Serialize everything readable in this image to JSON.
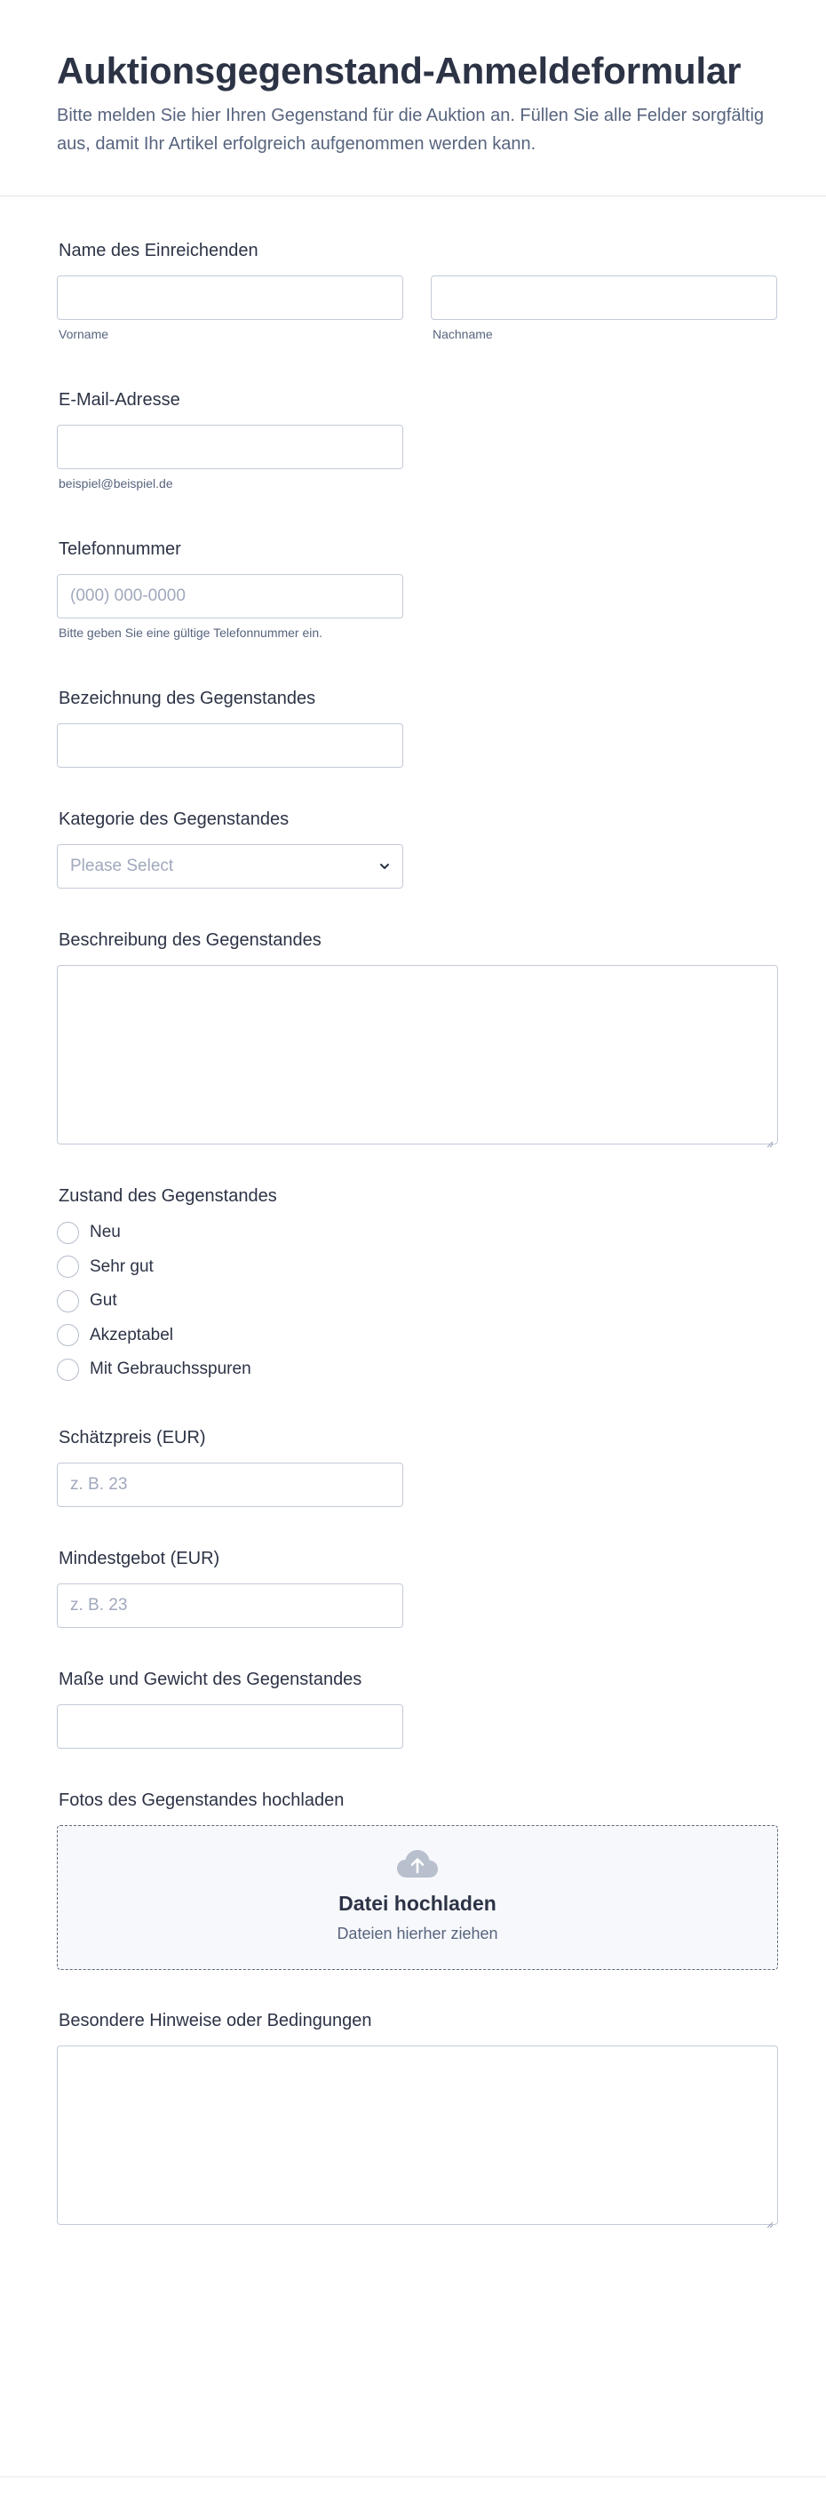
{
  "header": {
    "title": "Auktionsgegenstand-Anmeldeformular",
    "description": "Bitte melden Sie hier Ihren Gegenstand für die Auktion an. Füllen Sie alle Felder sorgfältig aus, damit Ihr Artikel erfolgreich aufgenommen werden kann."
  },
  "name": {
    "label": "Name des Einreichenden",
    "first_sublabel": "Vorname",
    "last_sublabel": "Nachname",
    "first_value": "",
    "last_value": ""
  },
  "email": {
    "label": "E-Mail-Adresse",
    "value": "",
    "sublabel": "beispiel@beispiel.de"
  },
  "phone": {
    "label": "Telefonnummer",
    "placeholder": "(000) 000-0000",
    "sublabel": "Bitte geben Sie eine gültige Telefonnummer ein."
  },
  "item_name": {
    "label": "Bezeichnung des Gegenstandes",
    "value": ""
  },
  "category": {
    "label": "Kategorie des Gegenstandes",
    "selected": "Please Select"
  },
  "description": {
    "label": "Beschreibung des Gegenstandes",
    "value": ""
  },
  "condition": {
    "label": "Zustand des Gegenstandes",
    "options": [
      "Neu",
      "Sehr gut",
      "Gut",
      "Akzeptabel",
      "Mit Gebrauchsspuren"
    ]
  },
  "estimate": {
    "label": "Schätzpreis (EUR)",
    "placeholder": "z. B. 23"
  },
  "min_bid": {
    "label": "Mindestgebot (EUR)",
    "placeholder": "z. B. 23"
  },
  "dimensions": {
    "label": "Maße und Gewicht des Gegenstandes",
    "value": ""
  },
  "photos": {
    "label": "Fotos des Gegenstandes hochladen",
    "icon": "cloud-upload-icon",
    "title": "Datei hochladen",
    "subtitle": "Dateien hierher ziehen"
  },
  "notes": {
    "label": "Besondere Hinweise oder Bedingungen",
    "value": ""
  },
  "colors": {
    "text": "#2c3345",
    "muted": "#57647e",
    "border": "#c3cad8",
    "upload_bg": "#f7f8fc"
  }
}
